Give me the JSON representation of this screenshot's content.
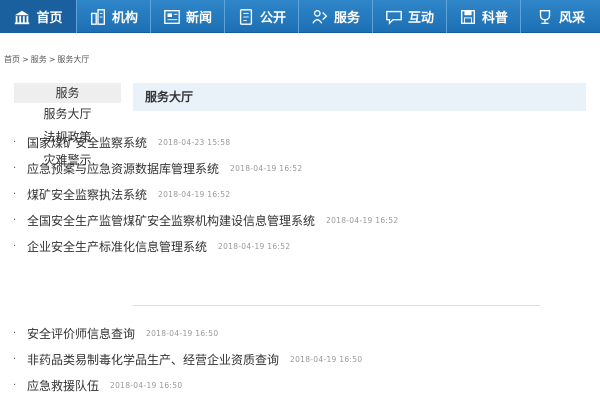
{
  "nav": [
    {
      "label": "首页",
      "icon": "building-icon"
    },
    {
      "label": "机构",
      "icon": "city-icon"
    },
    {
      "label": "新闻",
      "icon": "newspaper-icon"
    },
    {
      "label": "公开",
      "icon": "notebook-icon"
    },
    {
      "label": "服务",
      "icon": "service-icon"
    },
    {
      "label": "互动",
      "icon": "chat-icon"
    },
    {
      "label": "科普",
      "icon": "save-icon"
    },
    {
      "label": "风采",
      "icon": "trophy-icon"
    }
  ],
  "breadcrumb": [
    "首页",
    "服务",
    "服务大厅"
  ],
  "sidebar": {
    "header": "服务",
    "items": [
      "服务大厅",
      "法规政策",
      "灾难警示"
    ]
  },
  "main": {
    "title": "服务大厅",
    "group1": [
      {
        "title": "国家煤矿安全监察系统",
        "date": "2018-04-23 15:58"
      },
      {
        "title": "应急预案与应急资源数据库管理系统",
        "date": "2018-04-19 16:52"
      },
      {
        "title": "煤矿安全监察执法系统",
        "date": "2018-04-19 16:52"
      },
      {
        "title": "全国安全生产监管煤矿安全监察机构建设信息管理系统",
        "date": "2018-04-19 16:52"
      },
      {
        "title": "企业安全生产标准化信息管理系统",
        "date": "2018-04-19 16:52"
      }
    ],
    "group2": [
      {
        "title": "安全评价师信息查询",
        "date": "2018-04-19 16:50"
      },
      {
        "title": "非药品类易制毒化学品生产、经营企业资质查询",
        "date": "2018-04-19 16:50"
      },
      {
        "title": "应急救援队伍",
        "date": "2018-04-19 16:50"
      }
    ]
  },
  "colors": {
    "nav_bg": "#1d6fb3",
    "nav_active": "#1a5f9e",
    "header_bg": "#e9f2f9"
  }
}
